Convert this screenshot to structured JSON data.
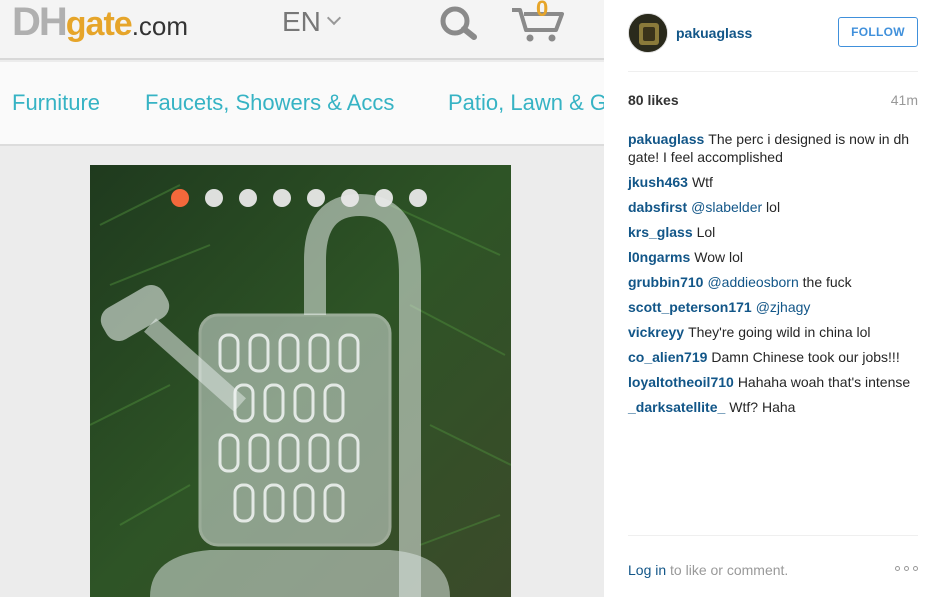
{
  "dhgate": {
    "logo_dh": "DH",
    "logo_gate": "gate",
    "logo_com": ".com",
    "language": "EN",
    "cart_count": "0",
    "categories": [
      "Furniture",
      "Faucets, Showers & Accs",
      "Patio, Lawn & G"
    ],
    "carousel": {
      "total": 8,
      "active_index": 0
    }
  },
  "instagram": {
    "username": "pakuaglass",
    "follow_label": "FOLLOW",
    "likes": "80 likes",
    "time": "41m",
    "comments": [
      {
        "user": "pakuaglass",
        "text": "The perc i designed is now in dh gate! I feel accomplished"
      },
      {
        "user": "jkush463",
        "text": "Wtf"
      },
      {
        "user": "dabsfirst",
        "mention": "@slabelder",
        "text": " lol"
      },
      {
        "user": "krs_glass",
        "text": "Lol"
      },
      {
        "user": "l0ngarms",
        "text": "Wow lol"
      },
      {
        "user": "grubbin710",
        "mention": "@addieosborn",
        "text": " the fuck"
      },
      {
        "user": "scott_peterson171",
        "mention": "@zjhagy",
        "text": ""
      },
      {
        "user": "vickreyy",
        "text": "They're going wild in china lol"
      },
      {
        "user": "co_alien719",
        "text": "Damn Chinese took our jobs!!!"
      },
      {
        "user": "loyaltotheoil710",
        "text": "Hahaha woah that's intense"
      },
      {
        "user": "_darksatellite_",
        "text": "Wtf? Haha"
      }
    ],
    "footer": {
      "login_link": "Log in",
      "login_rest": " to like or comment."
    }
  },
  "colors": {
    "ig_link": "#125688",
    "follow_blue": "#4090db",
    "dh_teal": "#36b3c4",
    "dh_orange": "#e6a52a",
    "carousel_active": "#ff6a3d"
  },
  "icons": [
    "search-icon",
    "cart-icon",
    "chevron-down-icon",
    "more-options-icon"
  ]
}
